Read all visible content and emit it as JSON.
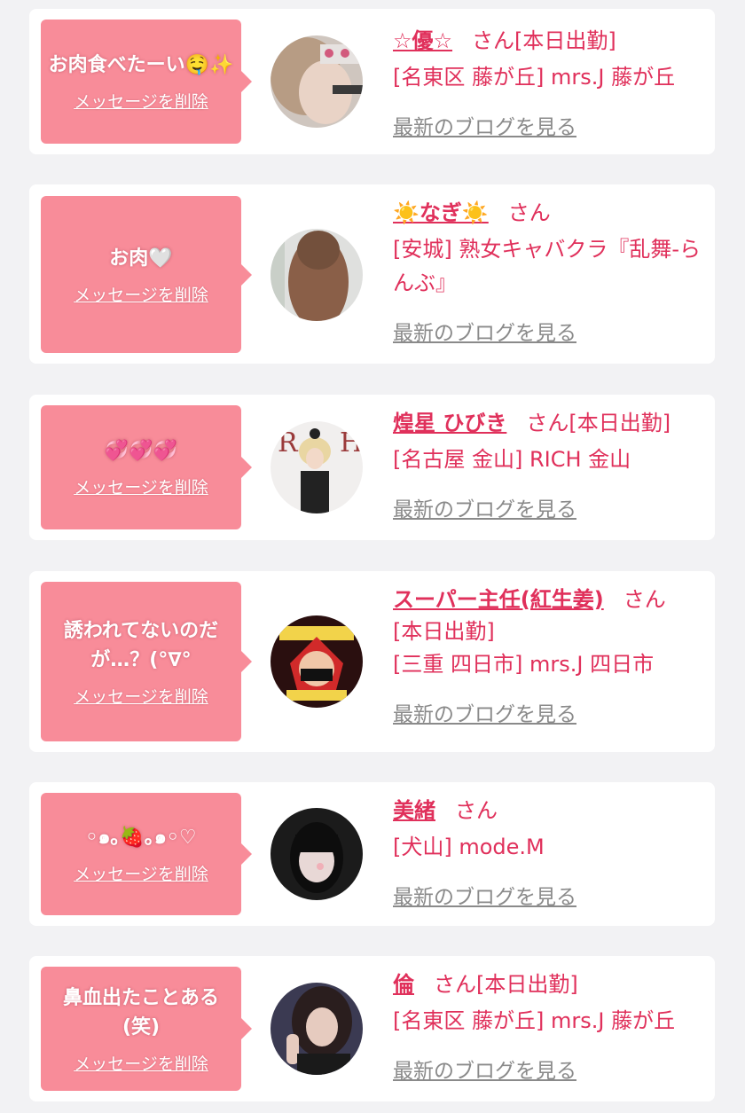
{
  "delete_label": "メッセージを削除",
  "blog_label": "最新のブログを見る",
  "honorific": "さん",
  "colors": {
    "bubble": "#f88c99",
    "name": "#e0305b",
    "blog_link": "#8a8a8a",
    "background": "#f2f2f4"
  },
  "messages": [
    {
      "message": "お肉食べたーい🤤✨",
      "cast_name": "☆優☆",
      "status": "[本日出勤]",
      "shop": "[名東区 藤が丘] mrs.J 藤が丘"
    },
    {
      "message": "お肉🤍",
      "cast_name": "☀️なぎ☀️",
      "status": "",
      "shop": "[安城] 熟女キャバクラ『乱舞-らんぶ』"
    },
    {
      "message": "💞💞💞",
      "cast_name": "煌星 ひびき",
      "status": "[本日出勤]",
      "shop": "[名古屋 金山] RICH 金山"
    },
    {
      "message": "誘われてないのだが…？(°∇°",
      "cast_name": "スーパー主任(紅生姜)",
      "status": "[本日出勤]",
      "shop": "[三重 四日市] mrs.J 四日市"
    },
    {
      "message": "◦๑｡🍓｡๑◦♡",
      "cast_name": "美緒",
      "status": "",
      "shop": "[犬山] mode.M"
    },
    {
      "message": "鼻血出たことある(笑)",
      "cast_name": "倫",
      "status": "[本日出勤]",
      "shop": "[名東区 藤が丘] mrs.J 藤が丘"
    }
  ]
}
